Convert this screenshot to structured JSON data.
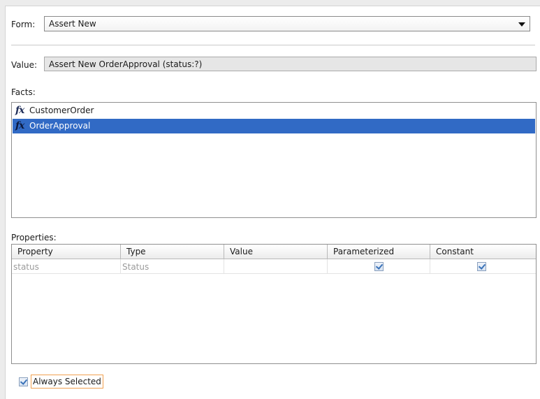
{
  "form": {
    "label": "Form:",
    "selected_value": "Assert New"
  },
  "value": {
    "label": "Value:",
    "text": "Assert New OrderApproval (status:?)"
  },
  "facts": {
    "label": "Facts:",
    "items": [
      {
        "icon": "fx-function-icon",
        "name": "CustomerOrder",
        "selected": false
      },
      {
        "icon": "fx-function-icon",
        "name": "OrderApproval",
        "selected": true
      }
    ],
    "icon_glyph": "fx"
  },
  "properties": {
    "label": "Properties:",
    "columns": [
      "Property",
      "Type",
      "Value",
      "Parameterized",
      "Constant"
    ],
    "rows": [
      {
        "property": "status",
        "type": "Status",
        "value": "",
        "parameterized": true,
        "constant": true
      }
    ]
  },
  "always_selected": {
    "label": "Always Selected",
    "checked": true
  },
  "colors": {
    "selection": "#316ac5",
    "focus_border": "#f0a050",
    "panel_bg": "#ffffff",
    "window_bg": "#ececec"
  }
}
